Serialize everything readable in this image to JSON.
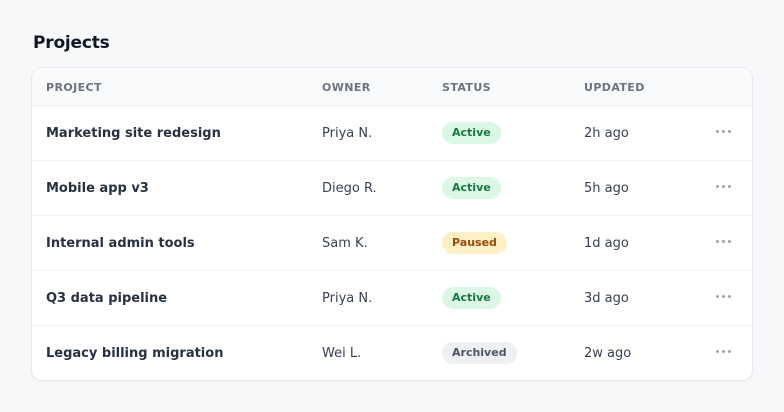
{
  "page": {
    "title": "Projects"
  },
  "table": {
    "columns": {
      "project": "PROJECT",
      "owner": "OWNER",
      "status": "STATUS",
      "updated": "UPDATED"
    },
    "rows": [
      {
        "project": "Marketing site redesign",
        "owner": "Priya N.",
        "status": "Active",
        "status_kind": "active",
        "updated": "2h ago",
        "actions_icon": "more-horizontal-icon"
      },
      {
        "project": "Mobile app v3",
        "owner": "Diego R.",
        "status": "Active",
        "status_kind": "active",
        "updated": "5h ago",
        "actions_icon": "more-horizontal-icon"
      },
      {
        "project": "Internal admin tools",
        "owner": "Sam K.",
        "status": "Paused",
        "status_kind": "paused",
        "updated": "1d ago",
        "actions_icon": "more-horizontal-icon"
      },
      {
        "project": "Q3 data pipeline",
        "owner": "Priya N.",
        "status": "Active",
        "status_kind": "active",
        "updated": "3d ago",
        "actions_icon": "more-horizontal-icon"
      },
      {
        "project": "Legacy billing migration",
        "owner": "Wei L.",
        "status": "Archived",
        "status_kind": "archived",
        "updated": "2w ago",
        "actions_icon": "more-horizontal-icon"
      }
    ]
  },
  "colors": {
    "background": "#f7f8fa",
    "card": "#ffffff",
    "active_bg": "#dcf7e6",
    "active_text": "#157a3f",
    "paused_bg": "#fdf0c4",
    "paused_text": "#9a4b0c",
    "archived_bg": "#eef0f4",
    "archived_text": "#4b5563"
  }
}
